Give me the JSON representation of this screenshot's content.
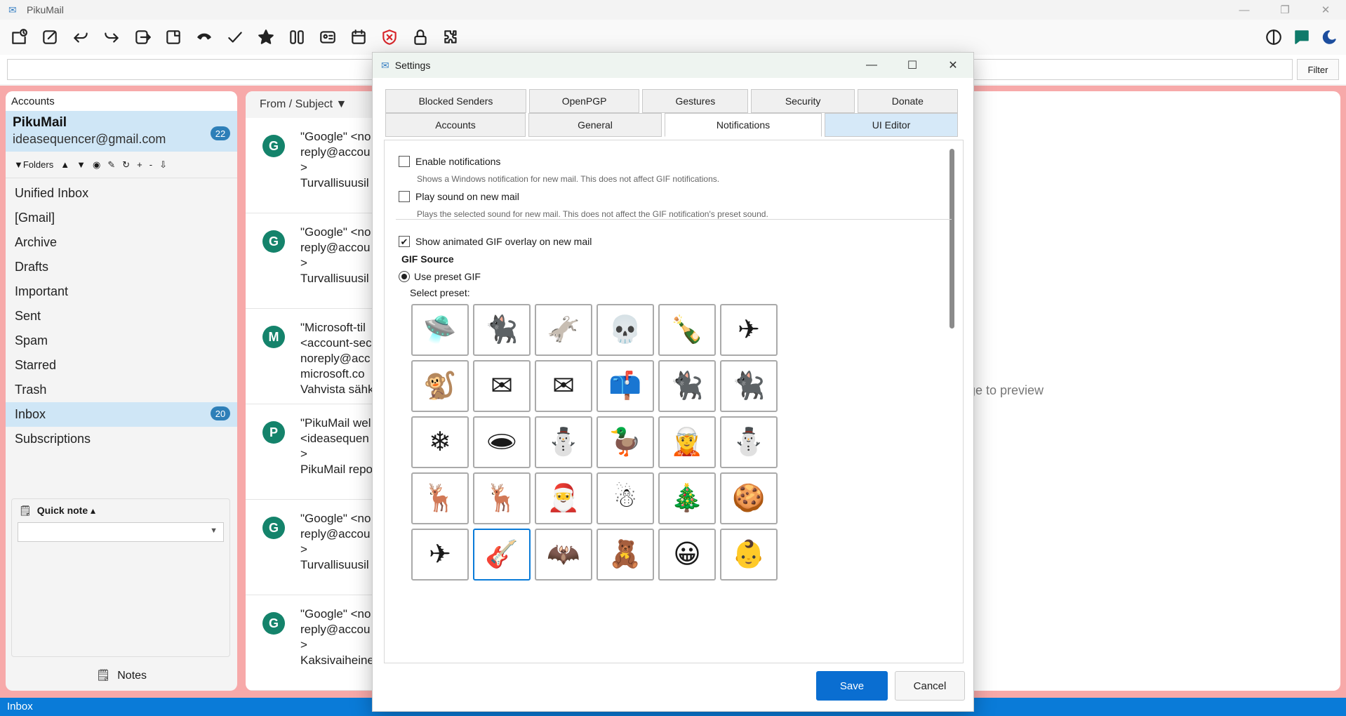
{
  "app": {
    "title": "PikuMail"
  },
  "toolbar": {
    "icons": [
      "compose-clock-icon",
      "compose-icon",
      "reply-icon",
      "forward-icon",
      "move-icon",
      "save-icon",
      "call-icon",
      "check-icon",
      "star-icon",
      "columns-icon",
      "contact-card-icon",
      "calendar-icon",
      "shield-icon",
      "lock-icon",
      "plugin-icon"
    ],
    "right_icons": [
      "contrast-icon",
      "chat-icon",
      "moon-icon"
    ]
  },
  "search": {
    "placeholder": "",
    "filter_label": "Filter"
  },
  "accounts": {
    "header": "Accounts",
    "account_name": "PikuMail",
    "account_email": "ideasequencer@gmail.com",
    "account_badge": "22",
    "folders_bar": {
      "label": "▼Folders",
      "controls": [
        "▲",
        "▼",
        "◉",
        "✎",
        "↻",
        "+",
        "-",
        "⇩"
      ]
    },
    "folders": [
      {
        "label": "Unified Inbox",
        "badge": ""
      },
      {
        "label": "[Gmail]",
        "badge": ""
      },
      {
        "label": "Archive",
        "badge": ""
      },
      {
        "label": "Drafts",
        "badge": ""
      },
      {
        "label": "Important",
        "badge": ""
      },
      {
        "label": "Sent",
        "badge": ""
      },
      {
        "label": "Spam",
        "badge": ""
      },
      {
        "label": "Starred",
        "badge": ""
      },
      {
        "label": "Trash",
        "badge": ""
      },
      {
        "label": "Inbox",
        "badge": "20"
      },
      {
        "label": "Subscriptions",
        "badge": ""
      }
    ],
    "quick_note": {
      "label": "Quick note ▴"
    },
    "notes_label": "Notes"
  },
  "messages": {
    "header": "From / Subject ▼",
    "items": [
      {
        "avatar": "G",
        "lines": [
          "\"Google\" <no",
          "reply@accou",
          ">",
          "Turvallisuusil"
        ]
      },
      {
        "avatar": "G",
        "lines": [
          "\"Google\" <no",
          "reply@accou",
          ">",
          "Turvallisuusil"
        ]
      },
      {
        "avatar": "M",
        "lines": [
          "\"Microsoft-til",
          "<account-sec",
          "noreply@acc",
          "microsoft.co",
          "Vahvista sähk"
        ]
      },
      {
        "avatar": "P",
        "lines": [
          "\"PikuMail wel",
          "<ideasequen",
          ">",
          "PikuMail repo"
        ]
      },
      {
        "avatar": "G",
        "lines": [
          "\"Google\" <no",
          "reply@accou",
          ">",
          "Turvallisuusil"
        ]
      },
      {
        "avatar": "G",
        "lines": [
          "\"Google\" <no",
          "reply@accou",
          ">",
          "Kaksivaiheine"
        ]
      }
    ]
  },
  "preview": {
    "text": "ge to preview"
  },
  "statusbar": {
    "text": "Inbox"
  },
  "dialog": {
    "title": "Settings",
    "tabs_row1": [
      "Blocked Senders",
      "OpenPGP",
      "Gestures",
      "Security",
      "Donate"
    ],
    "tabs_row2": [
      "Accounts",
      "General",
      "Notifications",
      "UI Editor"
    ],
    "enable_notifications": {
      "label": "Enable notifications",
      "checked": false,
      "desc": "Shows a Windows notification for new mail. This does not affect GIF notifications."
    },
    "play_sound": {
      "label": "Play sound on new mail",
      "checked": false,
      "desc": "Plays the selected sound for new mail. This does not affect the GIF notification's preset sound."
    },
    "gif_overlay": {
      "label": "Show animated GIF overlay on new mail",
      "checked": true
    },
    "gif_source_title": "GIF Source",
    "use_preset": {
      "label": "Use preset GIF",
      "selected": true
    },
    "select_preset_label": "Select preset:",
    "presets": [
      [
        "🛸",
        "🐈‍⬛",
        "🫏",
        "💀",
        "🍾",
        "✈"
      ],
      [
        "🐒",
        "✉",
        "✉",
        "📫",
        "🐈‍⬛",
        "🐈‍⬛"
      ],
      [
        "❄",
        "🕳",
        "⛄",
        "🦆",
        "🧝",
        "⛄"
      ],
      [
        "🦌",
        "🦌",
        "🎅",
        "☃",
        "🎄",
        "🍪"
      ],
      [
        "✈",
        "🎸",
        "🦇",
        "🧸",
        "😀",
        "👶"
      ]
    ],
    "selected_preset": "4,1",
    "save_label": "Save",
    "cancel_label": "Cancel"
  }
}
